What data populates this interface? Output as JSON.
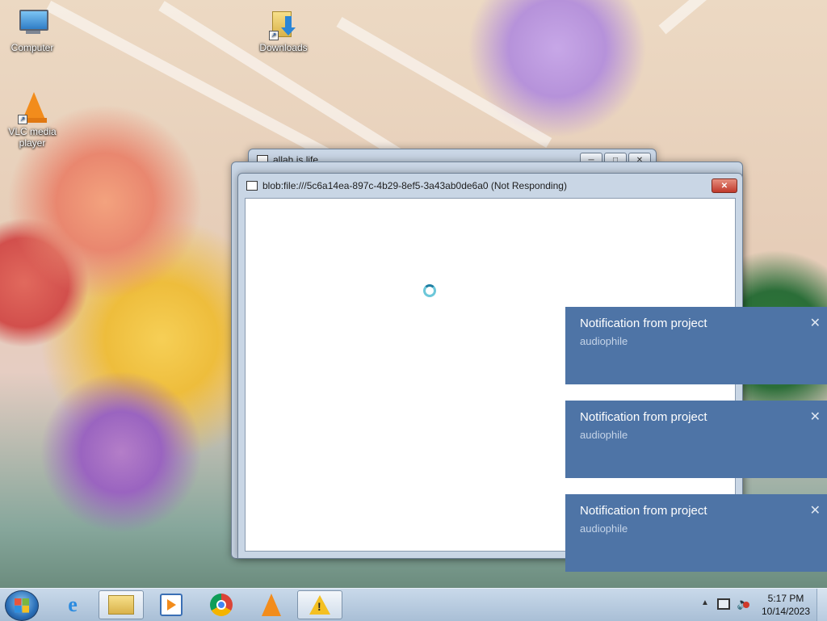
{
  "desktop": {
    "icons": [
      {
        "label": "Computer"
      },
      {
        "label": "Downloads"
      },
      {
        "label": "VLC media player"
      }
    ]
  },
  "windows": {
    "back": {
      "title": "allah is life"
    },
    "front": {
      "title": "blob:file:///5c6a14ea-897c-4b29-8ef5-3a43ab0de6a0 (Not Responding)"
    }
  },
  "notifications": [
    {
      "title": "Notification from project",
      "body": "audiophile"
    },
    {
      "title": "Notification from project",
      "body": "audiophile"
    },
    {
      "title": "Notification from project",
      "body": "audiophile"
    }
  ],
  "taskbar": {
    "pinned": [
      "ie-icon",
      "explorer-icon",
      "media-player-icon",
      "chrome-icon",
      "vlc-icon",
      "warning-icon"
    ],
    "clock": {
      "time": "5:17 PM",
      "date": "10/14/2023"
    }
  },
  "colors": {
    "toast_bg": "#4e74a6",
    "taskbar": "#b9cde2",
    "close_button": "#c0392b"
  }
}
